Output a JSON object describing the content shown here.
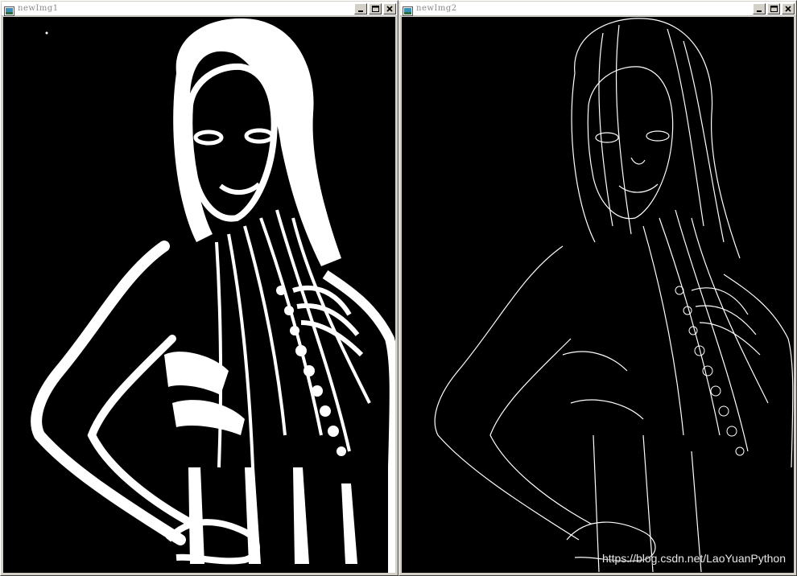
{
  "windows": [
    {
      "title": "newImg1",
      "controls": [
        "minimize",
        "maximize",
        "close"
      ]
    },
    {
      "title": "newImg2",
      "controls": [
        "minimize",
        "maximize",
        "close"
      ]
    }
  ],
  "watermark": "https://blog.csdn.net/LaoYuanPython",
  "colors": {
    "background": "#000000",
    "foreground": "#ffffff",
    "frame": "#d4d0c8"
  }
}
